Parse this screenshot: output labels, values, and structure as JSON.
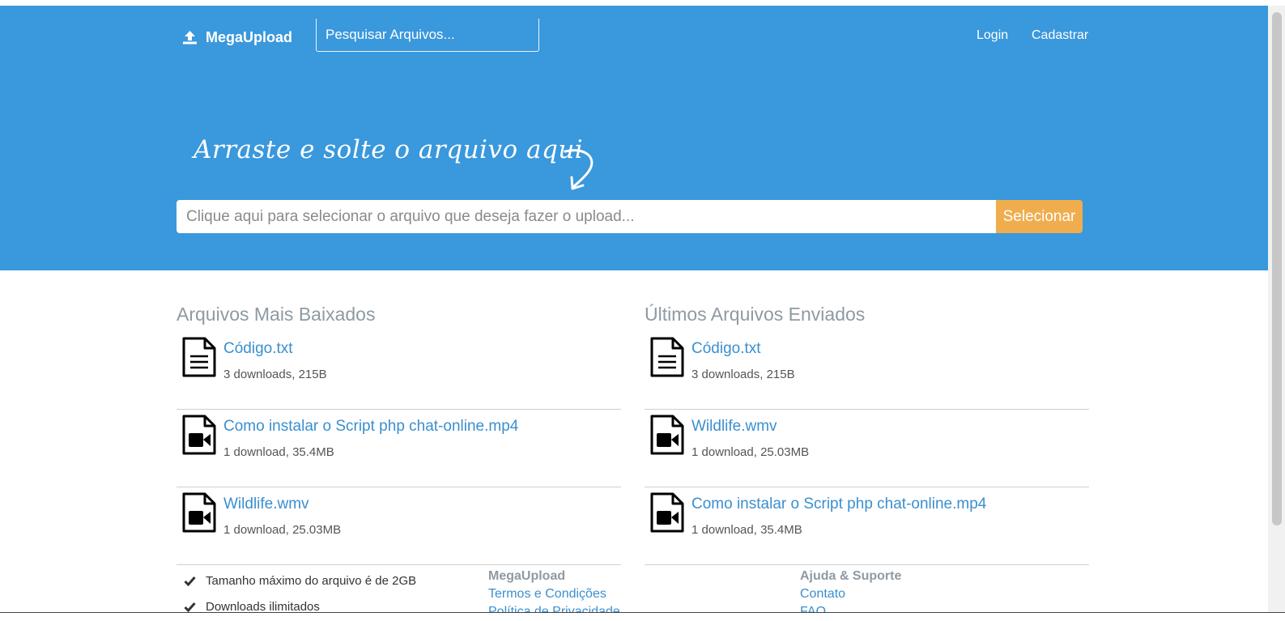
{
  "colors": {
    "hero_bg": "#3a98dc",
    "accent_button": "#f0ad4e",
    "link": "#3a8fcf",
    "heading_gray": "#8f9aa2"
  },
  "navbar": {
    "brand": "MegaUpload",
    "brand_icon": "upload-icon",
    "search_placeholder": "Pesquisar Arquivos...",
    "login": "Login",
    "signup": "Cadastrar"
  },
  "hero": {
    "title": "Arraste e solte o arquivo aqui",
    "file_placeholder": "Clique aqui para selecionar o arquivo que deseja fazer o upload...",
    "select_button": "Selecionar"
  },
  "most_downloaded": {
    "heading": "Arquivos Mais Baixados",
    "items": [
      {
        "name": "Código.txt",
        "meta": "3 downloads, 215B",
        "icon": "text-file-icon"
      },
      {
        "name": "Como instalar o Script php chat-online.mp4",
        "meta": "1 download, 35.4MB",
        "icon": "video-file-icon"
      },
      {
        "name": "Wildlife.wmv",
        "meta": "1 download, 25.03MB",
        "icon": "video-file-icon"
      }
    ]
  },
  "latest_uploads": {
    "heading": "Últimos Arquivos Enviados",
    "items": [
      {
        "name": "Código.txt",
        "meta": "3 downloads, 215B",
        "icon": "text-file-icon"
      },
      {
        "name": "Wildlife.wmv",
        "meta": "1 download, 25.03MB",
        "icon": "video-file-icon"
      },
      {
        "name": "Como instalar o Script php chat-online.mp4",
        "meta": "1 download, 35.4MB",
        "icon": "video-file-icon"
      }
    ]
  },
  "footer": {
    "features": [
      "Tamanho máximo do arquivo é de 2GB",
      "Downloads ilimitados"
    ],
    "megaupload": {
      "heading": "MegaUpload",
      "links": [
        "Termos e Condições",
        "Política de Privacidade"
      ]
    },
    "help": {
      "heading": "Ajuda & Suporte",
      "links": [
        "Contato",
        "FAQ"
      ]
    }
  }
}
